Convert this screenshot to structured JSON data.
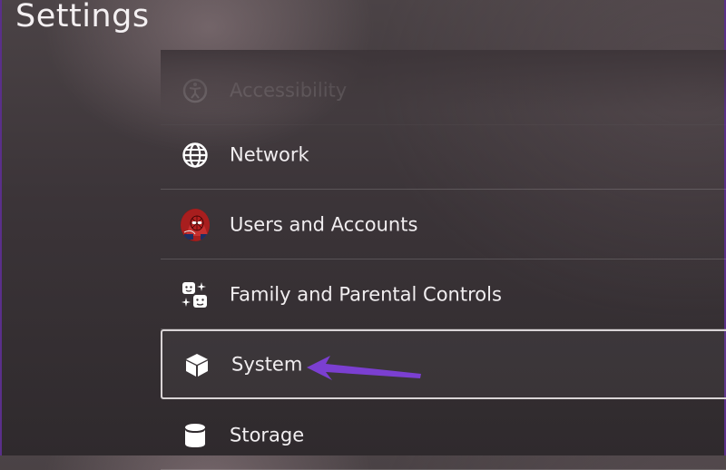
{
  "header": {
    "title": "Settings"
  },
  "menu": {
    "items": [
      {
        "id": "accessibility",
        "label": "Accessibility",
        "icon": "accessibility-icon"
      },
      {
        "id": "network",
        "label": "Network",
        "icon": "globe-icon"
      },
      {
        "id": "users",
        "label": "Users and Accounts",
        "icon": "avatar"
      },
      {
        "id": "family",
        "label": "Family and Parental Controls",
        "icon": "family-icon"
      },
      {
        "id": "system",
        "label": "System",
        "icon": "cube-icon",
        "selected": true
      },
      {
        "id": "storage",
        "label": "Storage",
        "icon": "database-icon"
      }
    ]
  },
  "colors": {
    "annotation_arrow": "#7b3fd1",
    "window_border": "#5a2f8a",
    "focus_border": "#d9d4d6"
  }
}
